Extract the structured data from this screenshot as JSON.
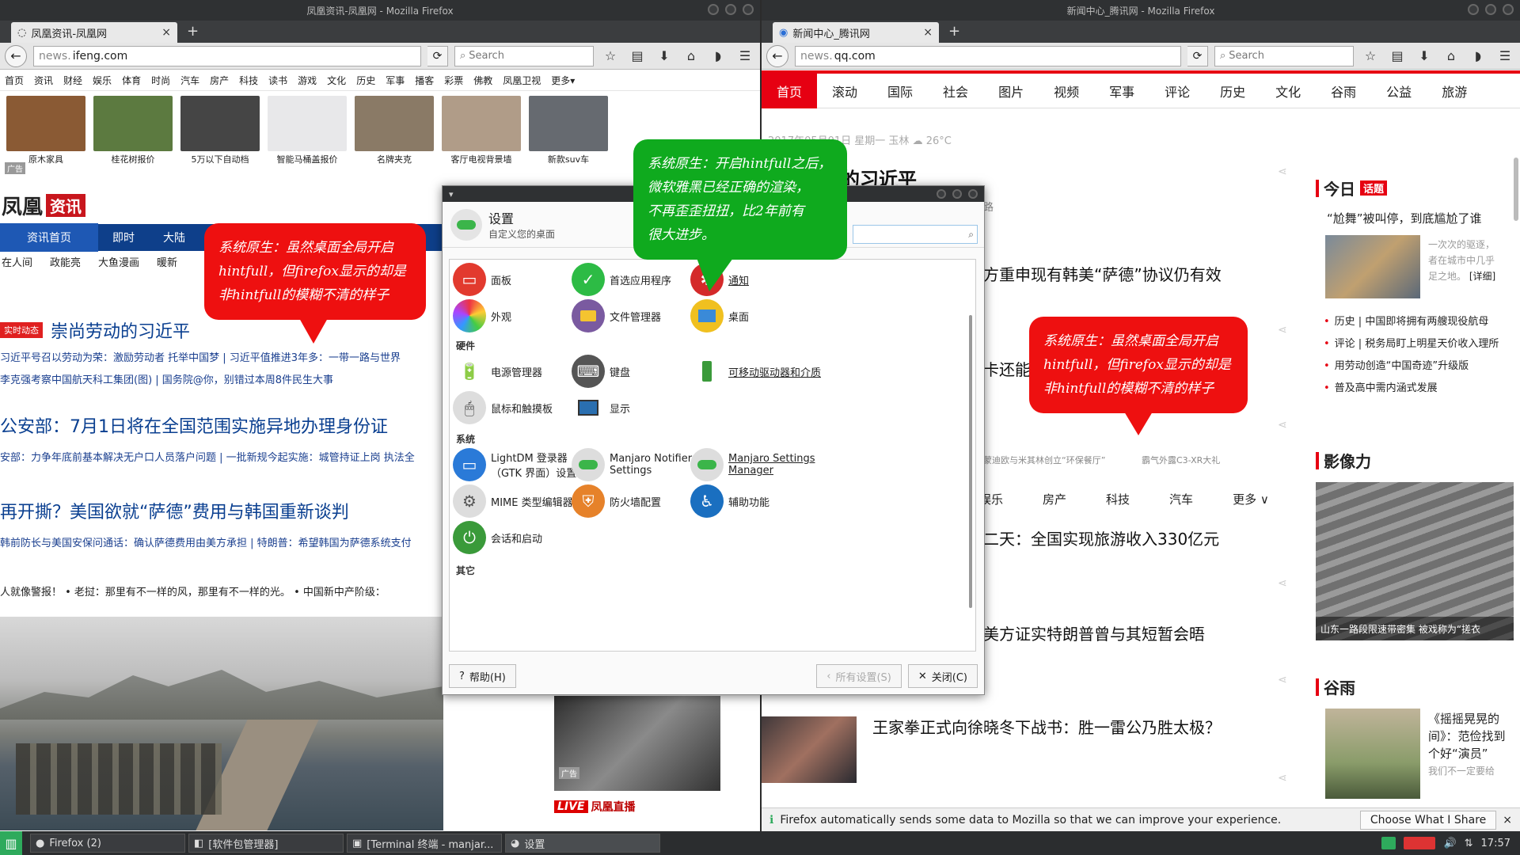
{
  "left": {
    "window_title": "凤凰资讯-凤凰网 - Mozilla Firefox",
    "tab_title": "凤凰资讯-凤凰网",
    "url_prefix": "news.",
    "url_domain": "ifeng.com",
    "search_placeholder": "Search",
    "nav": [
      "首页",
      "资讯",
      "财经",
      "娱乐",
      "体育",
      "时尚",
      "汽车",
      "房产",
      "科技",
      "读书",
      "游戏",
      "文化",
      "历史",
      "军事",
      "播客",
      "彩票",
      "佛教",
      "凤凰卫视",
      "更多▾"
    ],
    "ads": [
      {
        "caption": "原木家具",
        "color": "#8a5a34"
      },
      {
        "caption": "桂花树报价",
        "color": "#5c7a40"
      },
      {
        "caption": "5万以下自动档",
        "color": "#454545"
      },
      {
        "caption": "智能马桶盖报价",
        "color": "#e8e8ea"
      },
      {
        "caption": "名牌夹克",
        "color": "#8a7a66"
      },
      {
        "caption": "客厅电视背景墙",
        "color": "#b09c88"
      },
      {
        "caption": "新款suv车",
        "color": "#666a70"
      }
    ],
    "ad_label": "广告",
    "logo_text": "凤凰",
    "logo_badge": "资讯",
    "menu": [
      "资讯首页",
      "即时",
      "大陆"
    ],
    "sub_menu": [
      "在人间",
      "政能亮",
      "大鱼漫画",
      "暖新"
    ],
    "live_badge": "实时动态",
    "hot_headline": "崇尚劳动的习近平",
    "hot_links1": "习近平号召以劳动为荣：激励劳动者 托举中国梦 | 习近平值",
    "hot_links1b": "推进3年多：一带一路与世界",
    "hot_links2": "李克强考察中国航天科工集团(图) | 国务院@你，别错过本周8件民生大事",
    "headline2": "公安部：7月1日将在全国范围实施异地办理身份证",
    "links3": "安部：力争年底前基本解决无户口人员落户问题 | 一批新规今起实施：城管持证上岗 执法全",
    "headline3": "再开撕？美国欲就“萨德”费用与韩国重新谈判",
    "links4": "韩前防长与美国安保问通话：确认萨德费用由美方承担 | 特朗普：希望韩国为萨德系统支付",
    "links5": "人就像警报！   •  老挝：那里有不一样的风，那里有不一样的光。   •  中国新中产阶级：",
    "ad2_label": "广告",
    "live_text": "LIVE",
    "live_label": "凤凰直播"
  },
  "right": {
    "window_title": "新闻中心_腾讯网 - Mozilla Firefox",
    "tab_title": "新闻中心_腾讯网",
    "url_prefix": "news.",
    "url_domain": "qq.com",
    "search_placeholder": "Search",
    "nav": [
      "首页",
      "滚动",
      "国际",
      "社会",
      "图片",
      "视频",
      "军事",
      "评论",
      "历史",
      "文化",
      "谷雨",
      "公益",
      "旅游"
    ],
    "date": "2017年05月01日    星期一    玉林 ☁ 26°C",
    "title1": "的习近平",
    "cap_tail": "路",
    "title2": "方重申现有韩美“萨德”协议仍有效",
    "title3": "卡还能",
    "caption_a": "蒙迪欧与米其林创立“环保餐厅”",
    "caption_b": "霸气外露C3-XR大礼",
    "cats": [
      "娱乐",
      "房产",
      "科技",
      "汽车",
      "更多 ∨"
    ],
    "title4": "二天：全国实现旅游收入330亿元",
    "title5": "美方证实特朗普曾与其短暂会晤",
    "title6": "王家拳正式向徐晓冬下战书：胜一雷公乃胜太极？",
    "side_today": "今日",
    "side_today_badge": "话题",
    "side_today_hl": "“尬舞”被叫停，到底尴尬了谁",
    "side_today_txt1": "一次次的驱逐，",
    "side_today_txt2": "者在城市中几乎",
    "side_today_txt3": "足之地。",
    "side_today_more": "[详细]",
    "side_list": [
      "历史 | 中国即将拥有两艘现役航母",
      "评论 | 税务局盯上明星天价收入理所",
      "用劳动创造“中国奇迹”升级版",
      "普及高中需内涵式发展"
    ],
    "side_yxl": "影像力",
    "side_yxl_cap": "山东一路段限速带密集 被戏称为“搓衣",
    "side_gy": "谷雨",
    "side_gy_t1": "《摇摇晃晃的",
    "side_gy_t2": "间》：范俭找到",
    "side_gy_t3": "个好“演员”",
    "side_gy_t4": "我们不一定要给",
    "notice": "Firefox automatically sends some data to Mozilla so that we can improve your experience.",
    "notice_btn": "Choose What I Share",
    "notice_close": "×"
  },
  "settings": {
    "title": "设置",
    "subtitle": "自定义您的桌面",
    "search_value": "",
    "sections": {
      "hardware": "硬件",
      "system": "系统",
      "other": "其它"
    },
    "items": {
      "panel": "面板",
      "preferred": "首选应用程序",
      "notify": "通知",
      "appearance": "外观",
      "filemgr": "文件管理器",
      "desktop": "桌面",
      "power": "电源管理器",
      "keyboard": "键盘",
      "removable": "可移动驱动器和介质",
      "mouse": "鼠标和触摸板",
      "display": "显示",
      "lightdm1": "LightDM 登录器",
      "lightdm2": "（GTK 界面）设置",
      "notifier1": "Manjaro Notifier",
      "notifier2": "Settings",
      "msm1": "Manjaro Settings",
      "msm2": "Manager",
      "mime": "MIME 类型编辑器",
      "firewall": "防火墙配置",
      "access": "辅助功能",
      "session": "会话和启动"
    },
    "help_btn": "帮助(H)",
    "all_btn": "所有设置(S)",
    "close_btn": "关闭(C)"
  },
  "bubbles": {
    "left": [
      "系统原生：虽然桌面全局开启",
      "hintfull，但firefox显示的却是",
      "非hintfull的模糊不清的样子"
    ],
    "right": [
      "系统原生：虽然桌面全局开启",
      "hintfull，但firefox显示的却是",
      "非hintfull的模糊不清的样子"
    ],
    "center": [
      "系统原生：开启hintfull之后，",
      "微软雅黑已经正确的渲染，",
      "不再歪歪扭扭，比2年前有",
      "很大进步。"
    ]
  },
  "taskbar": {
    "tasks": [
      "Firefox (2)",
      "[软件包管理器]",
      "[Terminal 终端 - manjar...",
      "设置"
    ],
    "clock": "17:57"
  },
  "colors": {
    "ifeng_blue": "#0e3f8a",
    "qq_red": "#e60012",
    "bubble_red": "#ee1010",
    "bubble_green": "#0faa1e"
  }
}
